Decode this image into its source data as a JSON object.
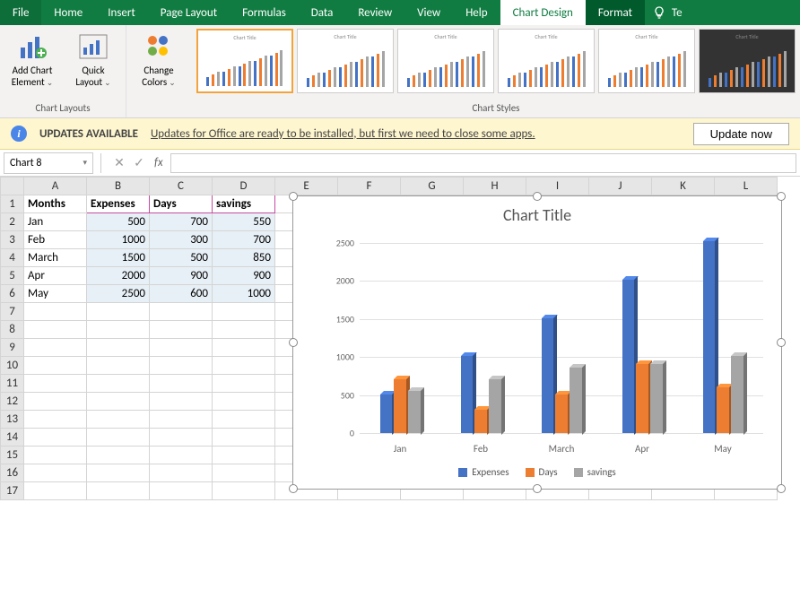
{
  "tabs": [
    "File",
    "Home",
    "Insert",
    "Page Layout",
    "Formulas",
    "Data",
    "Review",
    "View",
    "Help",
    "Chart Design",
    "Format"
  ],
  "active_tab": 9,
  "tell_me": "Te",
  "ribbon": {
    "add_chart_element": "Add Chart Element",
    "quick_layout": "Quick Layout",
    "chart_layouts_group": "Chart Layouts",
    "change_colors": "Change Colors",
    "chart_styles_group": "Chart Styles"
  },
  "update": {
    "title": "UPDATES AVAILABLE",
    "msg": "Updates for Office are ready to be installed, but first we need to close some apps.",
    "button": "Update now"
  },
  "name_box": "Chart 8",
  "fx": "fx",
  "columns": [
    "A",
    "B",
    "C",
    "D",
    "E",
    "F",
    "G",
    "H",
    "I",
    "J",
    "K",
    "L"
  ],
  "row_count": 17,
  "headers": [
    "Months",
    "Expenses",
    "Days",
    "savings"
  ],
  "rows": [
    {
      "m": "Jan",
      "e": 500,
      "d": 700,
      "s": 550
    },
    {
      "m": "Feb",
      "e": 1000,
      "d": 300,
      "s": 700
    },
    {
      "m": "March",
      "e": 1500,
      "d": 500,
      "s": 850
    },
    {
      "m": "Apr",
      "e": 2000,
      "d": 900,
      "s": 900
    },
    {
      "m": "May",
      "e": 2500,
      "d": 600,
      "s": 1000
    }
  ],
  "chart_data": {
    "type": "bar",
    "title": "Chart Title",
    "categories": [
      "Jan",
      "Feb",
      "March",
      "Apr",
      "May"
    ],
    "series": [
      {
        "name": "Expenses",
        "values": [
          500,
          1000,
          1500,
          2000,
          2500
        ],
        "color": "#4472c4"
      },
      {
        "name": "Days",
        "values": [
          700,
          300,
          500,
          900,
          600
        ],
        "color": "#ed7d31"
      },
      {
        "name": "savings",
        "values": [
          550,
          700,
          850,
          900,
          1000
        ],
        "color": "#a5a5a5"
      }
    ],
    "ylim": [
      0,
      2500
    ],
    "yticks": [
      0,
      500,
      1000,
      1500,
      2000,
      2500
    ],
    "xlabel": "",
    "ylabel": ""
  }
}
